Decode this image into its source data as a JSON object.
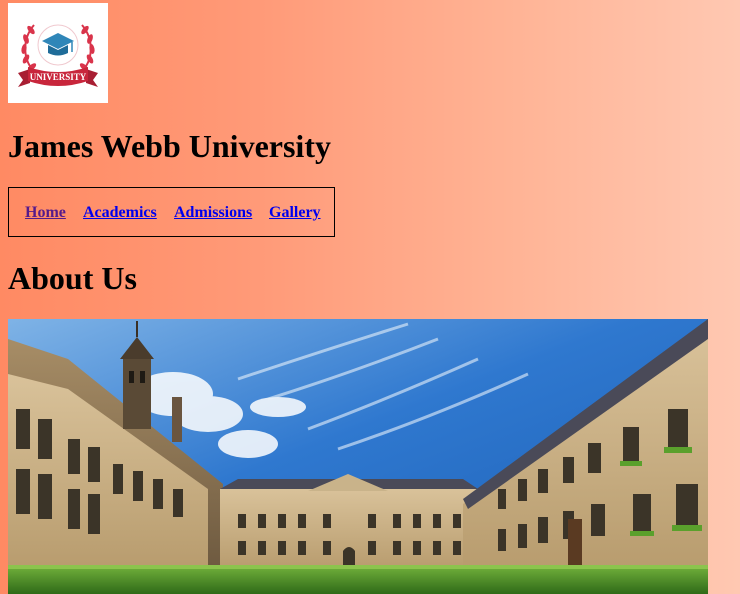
{
  "logo": {
    "alt": "University logo",
    "text": "UNIVERSITY",
    "colors": {
      "wreath": "#d9344b",
      "cap": "#2f86b8",
      "banner": "#c8263c"
    }
  },
  "site": {
    "title": "James Webb University"
  },
  "nav": {
    "items": [
      {
        "label": "Home",
        "visited": true
      },
      {
        "label": "Academics",
        "visited": false
      },
      {
        "label": "Admissions",
        "visited": false
      },
      {
        "label": "Gallery",
        "visited": false
      }
    ]
  },
  "about": {
    "heading": "About Us"
  },
  "photo": {
    "alt": "University campus courtyard with historic stone buildings under a blue sky"
  }
}
